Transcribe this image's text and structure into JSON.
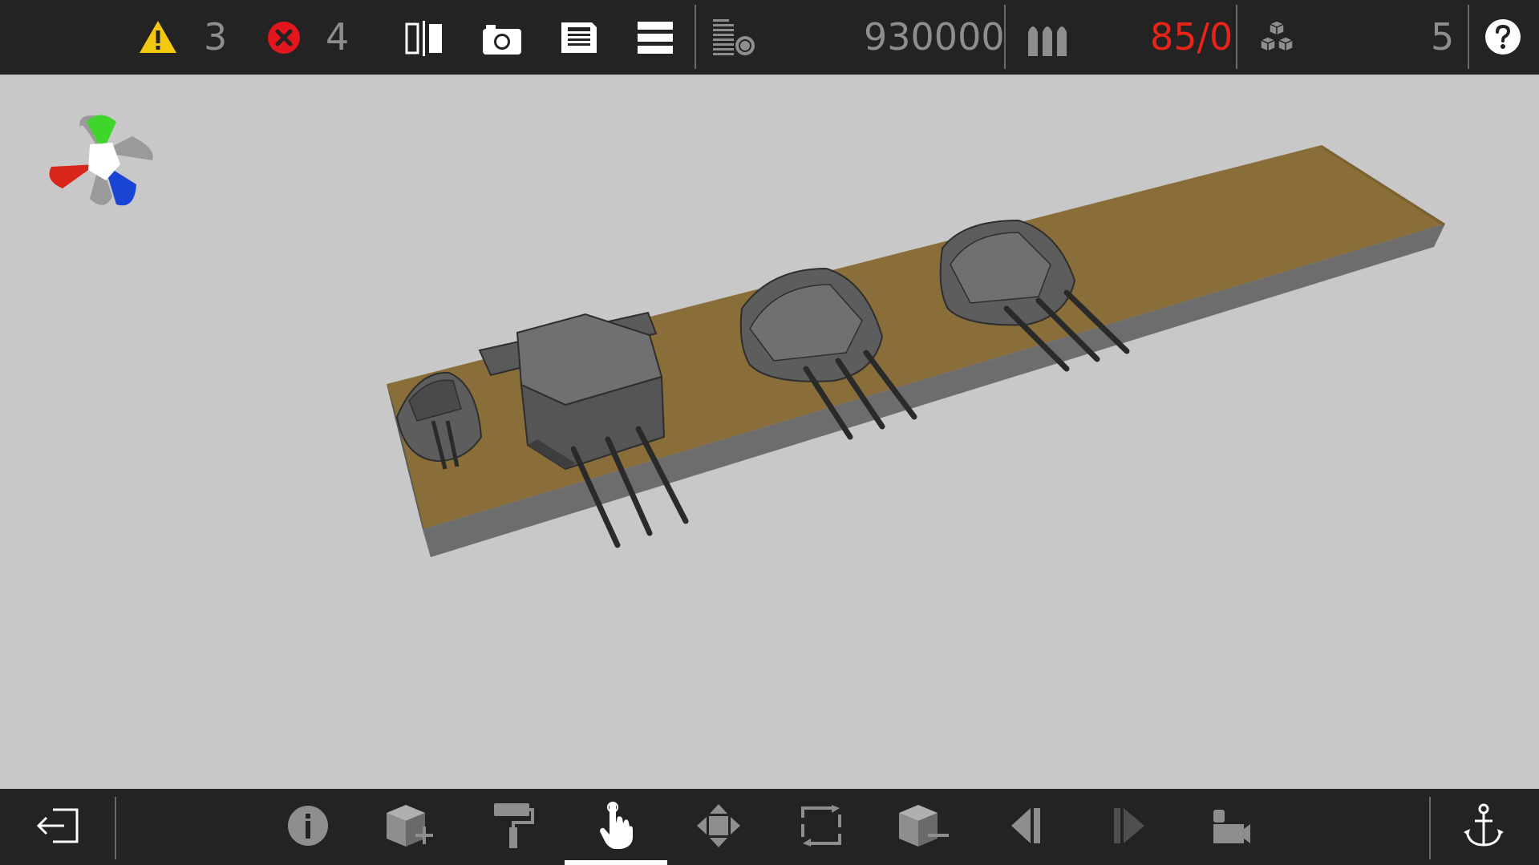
{
  "top_toolbar": {
    "warning_count": "3",
    "error_count": "4",
    "cost": "930000",
    "ammo": "85/0",
    "parts_count": "5",
    "icons": [
      "warning-icon",
      "error-icon",
      "mirror-icon",
      "camera-icon",
      "save-icon",
      "menu-icon",
      "weight-icon",
      "ammo-icon",
      "parts-icon",
      "help-icon"
    ]
  },
  "bottom_toolbar": {
    "icons": [
      "exit-icon",
      "info-icon",
      "add-part-icon",
      "paint-icon",
      "select-hand-icon",
      "move-icon",
      "rotate-icon",
      "remove-part-icon",
      "previous-icon",
      "next-icon",
      "camera-view-icon",
      "anchor-icon"
    ],
    "active": "select-hand-icon"
  },
  "colors": {
    "toolbar_bg": "#232323",
    "viewport_bg": "#c8c8c8",
    "text_gray": "#8e8e8e",
    "ammo_red": "#e8231a",
    "warning_yellow": "#f2c811",
    "error_red": "#e3151d",
    "hull_deck": "#8a6e3a",
    "hull_side": "#6d6d6d"
  },
  "scene": {
    "objects": [
      "hull-deck",
      "small-secondary-turret",
      "main-turret-large-a",
      "main-turret-b",
      "main-turret-c",
      "orientation-gizmo"
    ]
  }
}
